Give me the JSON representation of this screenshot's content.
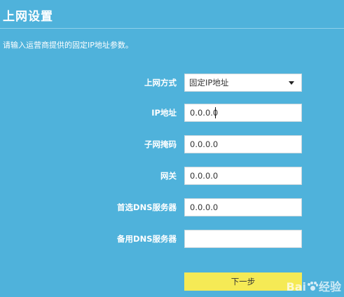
{
  "page": {
    "title": "上网设置",
    "hint": "请输入运营商提供的固定IP地址参数。"
  },
  "form": {
    "connection_type": {
      "label": "上网方式",
      "selected": "固定IP地址"
    },
    "ip_address": {
      "label": "IP地址",
      "value": "0.0.0.0"
    },
    "subnet_mask": {
      "label": "子网掩码",
      "value": "0.0.0.0"
    },
    "gateway": {
      "label": "网关",
      "value": "0.0.0.0"
    },
    "primary_dns": {
      "label": "首选DNS服务器",
      "value": "0.0.0.0"
    },
    "secondary_dns": {
      "label": "备用DNS服务器",
      "value": ""
    },
    "next_button": "下一步"
  },
  "watermark": {
    "text_left": "Bai",
    "text_right": "经验"
  },
  "colors": {
    "background": "#4fb2db",
    "button": "#f5ea55",
    "text": "#ffffff"
  }
}
